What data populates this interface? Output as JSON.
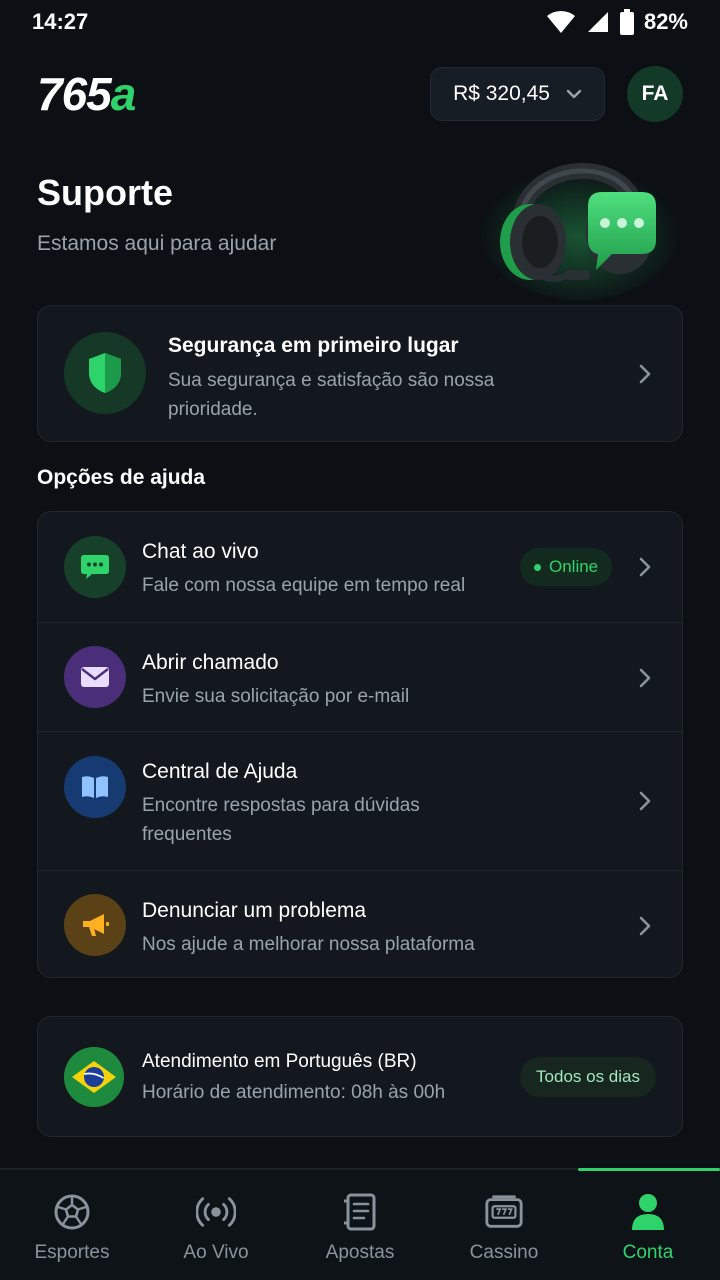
{
  "status_bar": {
    "time": "14:27",
    "battery": "82%"
  },
  "header": {
    "logo_main": "765",
    "logo_accent": "a",
    "balance": "R$ 320,45",
    "avatar_initials": "FA"
  },
  "hero": {
    "title": "Suporte",
    "subtitle": "Estamos aqui para ajudar"
  },
  "security": {
    "title": "Segurança em primeiro lugar",
    "text": "Sua segurança e satisfação são nossa prioridade."
  },
  "help": {
    "section_label": "Opções de ajuda",
    "options": [
      {
        "title": "Chat ao vivo",
        "subtitle": "Fale com nossa equipe em tempo real",
        "badge": "Online",
        "icon": "chat-icon"
      },
      {
        "title": "Abrir chamado",
        "subtitle": "Envie sua solicitação por e-mail",
        "icon": "mail-icon"
      },
      {
        "title": "Central de Ajuda",
        "subtitle": "Encontre respostas para dúvidas frequentes",
        "icon": "book-icon"
      },
      {
        "title": "Denunciar um problema",
        "subtitle": "Nos ajude a melhorar nossa plataforma",
        "icon": "megaphone-icon"
      }
    ]
  },
  "language": {
    "title": "Atendimento em Português (BR)",
    "hours": "Horário de atendimento: 08h às 00h",
    "badge": "Todos os dias"
  },
  "nav": {
    "items": [
      {
        "label": "Esportes",
        "icon": "soccer-ball-icon"
      },
      {
        "label": "Ao Vivo",
        "icon": "live-broadcast-icon"
      },
      {
        "label": "Apostas",
        "icon": "bet-slip-icon"
      },
      {
        "label": "Cassino",
        "icon": "slot-machine-icon"
      },
      {
        "label": "Conta",
        "icon": "user-icon",
        "active": true
      }
    ]
  },
  "colors": {
    "accent": "#2fd36b",
    "background": "#0c1014",
    "card": "#12181e",
    "muted_text": "#9aa3ad"
  }
}
